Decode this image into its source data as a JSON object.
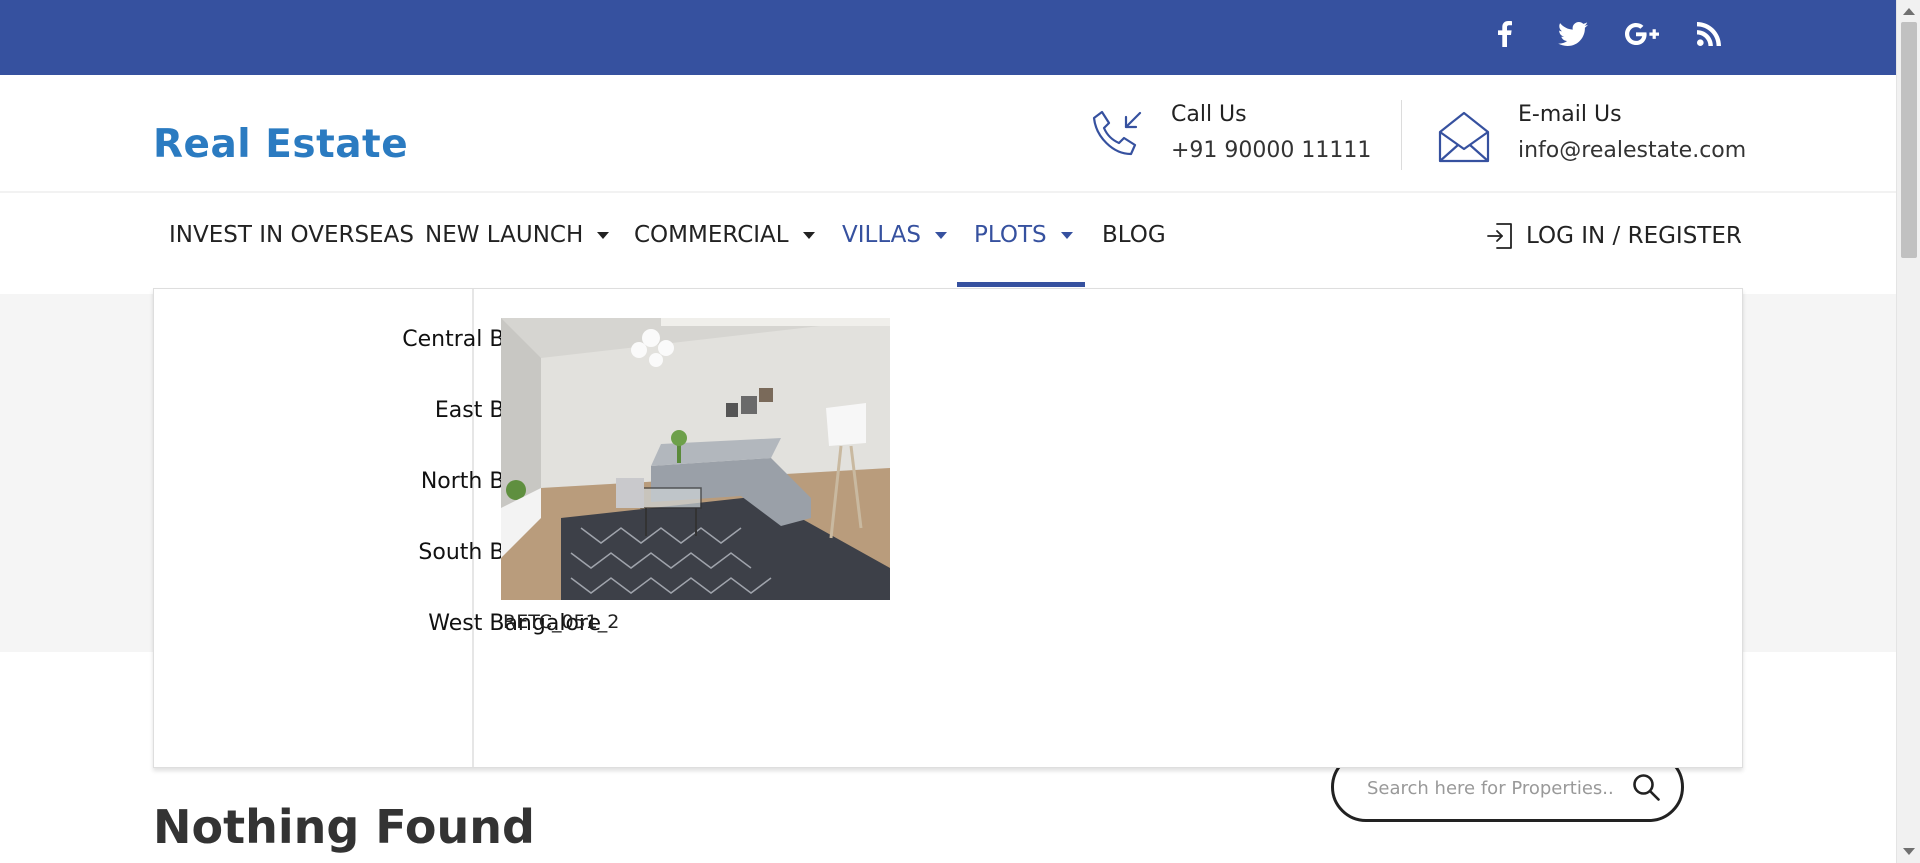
{
  "social": {
    "items": [
      {
        "icon": "facebook-icon"
      },
      {
        "icon": "twitter-icon"
      },
      {
        "icon": "google-plus-icon"
      },
      {
        "icon": "rss-icon"
      }
    ]
  },
  "header": {
    "logo": "Real Estate",
    "call": {
      "label": "Call Us",
      "value": "+91 90000 11111",
      "icon": "phone-incoming-icon"
    },
    "email": {
      "label": "E-mail Us",
      "value": "info@realestate.com",
      "icon": "envelope-icon"
    }
  },
  "nav": {
    "items": [
      {
        "label": "INVEST IN OVERSEAS",
        "dropdown": false,
        "active": false
      },
      {
        "label": "NEW LAUNCH",
        "dropdown": true,
        "active": false
      },
      {
        "label": "COMMERCIAL",
        "dropdown": true,
        "active": false
      },
      {
        "label": "VILLAS",
        "dropdown": true,
        "active": true
      },
      {
        "label": "PLOTS",
        "dropdown": true,
        "active": true
      },
      {
        "label": "BLOG",
        "dropdown": false,
        "active": false
      }
    ],
    "login": "LOG IN / REGISTER",
    "accent_color": "#36519f"
  },
  "mega_menu": {
    "links": [
      "Central Bangalore",
      "East Bangalore",
      "North Bangalore",
      "South Bangalore",
      "West Bangalore"
    ],
    "featured_caption": "RETC_051_2"
  },
  "search": {
    "placeholder": "Search here for Properties.."
  },
  "main": {
    "heading": "Nothing Found"
  },
  "colors": {
    "topbar": "#36519f",
    "logo": "#2b7bc1"
  }
}
